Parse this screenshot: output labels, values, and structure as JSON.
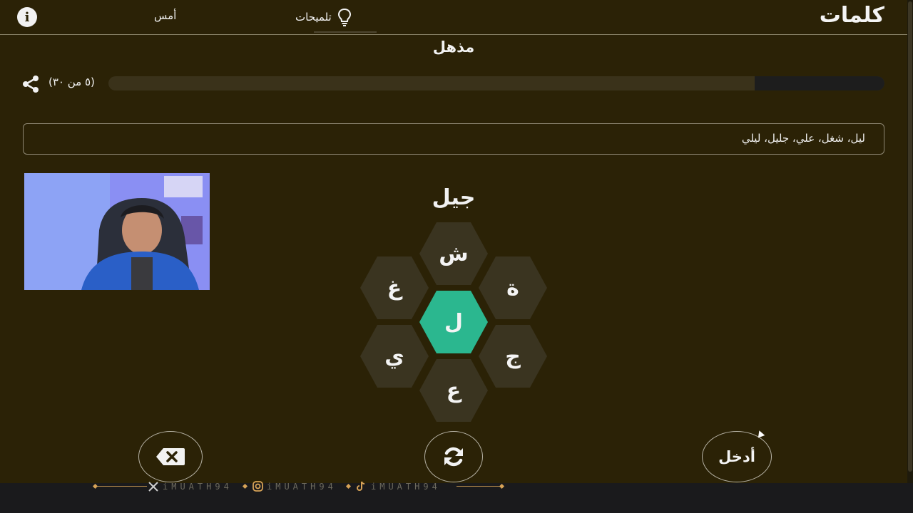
{
  "header": {
    "logo": "كلمات",
    "hints_label": "تلميحات",
    "yesterday_label": "أمس",
    "info_glyph": "i"
  },
  "rank": "مذهل",
  "score_text": "(٥ من ٣٠)",
  "progress": {
    "found": 5,
    "total": 30,
    "fraction": 0.167
  },
  "found_words_text": "ليل، شغل، علي، جليل، ليلي",
  "current_word": "جيل",
  "letters": {
    "center": "ل",
    "top": "ش",
    "top_right": "ة",
    "bottom_right": "ج",
    "bottom": "ع",
    "bottom_left": "ي",
    "top_left": "غ"
  },
  "buttons": {
    "enter_label": "أدخل",
    "shuffle_icon": "refresh-icon",
    "delete_icon": "backspace-icon"
  },
  "footer_handles": [
    "iMUATH94",
    "iMUATH94",
    "iMUATH94"
  ],
  "colors": {
    "background": "#2b2206",
    "center_hex": "#2bb78f",
    "outer_hex": "#3a3420",
    "accent_line": "#b68a4a"
  }
}
